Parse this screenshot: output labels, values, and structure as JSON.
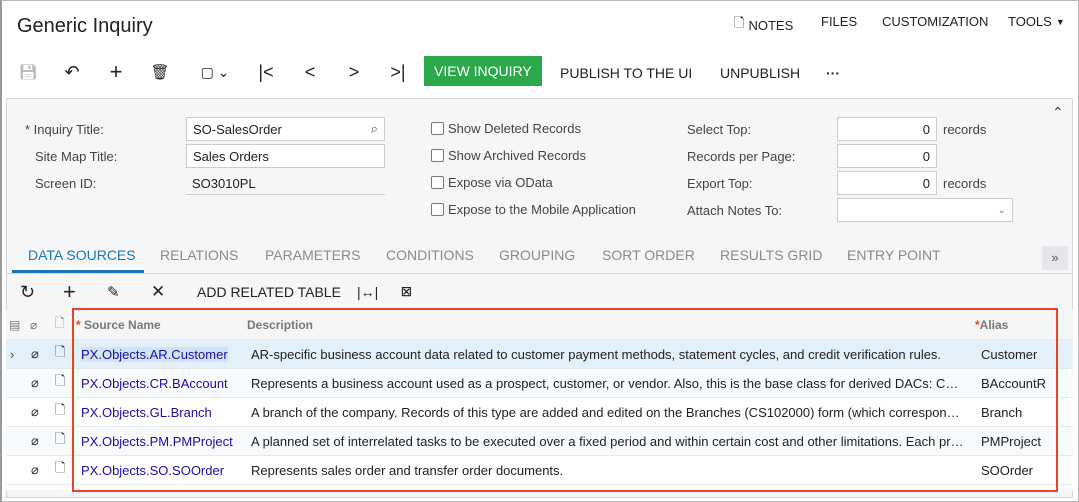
{
  "header": {
    "title": "Generic Inquiry",
    "notes": "NOTES",
    "files": "FILES",
    "customization": "CUSTOMIZATION",
    "tools": "TOOLS"
  },
  "toolbar": {
    "view_inquiry": "VIEW INQUIRY",
    "publish": "PUBLISH TO THE UI",
    "unpublish": "UNPUBLISH",
    "more": "···"
  },
  "form": {
    "inquiry_title_label": "Inquiry Title:",
    "inquiry_title": "SO-SalesOrder",
    "site_map_title_label": "Site Map Title:",
    "site_map_title": "Sales Orders",
    "screen_id_label": "Screen ID:",
    "screen_id": "SO3010PL",
    "show_deleted": "Show Deleted Records",
    "show_archived": "Show Archived Records",
    "expose_odata": "Expose via OData",
    "expose_mobile": "Expose to the Mobile Application",
    "select_top_label": "Select Top:",
    "select_top": "0",
    "records": "records",
    "records_per_page_label": "Records per Page:",
    "records_per_page": "0",
    "export_top_label": "Export Top:",
    "export_top": "0",
    "attach_notes_label": "Attach Notes To:",
    "attach_notes": ""
  },
  "tabs": [
    "DATA SOURCES",
    "RELATIONS",
    "PARAMETERS",
    "CONDITIONS",
    "GROUPING",
    "SORT ORDER",
    "RESULTS GRID",
    "ENTRY POINT"
  ],
  "grid_toolbar": {
    "add_related": "ADD RELATED TABLE"
  },
  "grid": {
    "columns": {
      "source": "Source Name",
      "description": "Description",
      "alias": "Alias"
    },
    "rows": [
      {
        "source": "PX.Objects.AR.Customer",
        "description": "AR-specific business account data related to customer payment methods, statement cycles, and credit verification rules.",
        "alias": "Customer"
      },
      {
        "source": "PX.Objects.CR.BAccount",
        "description": "Represents a business account used as a prospect, customer, or vendor. Also, this is the base class for derived DACs: C…",
        "alias": "BAccountR"
      },
      {
        "source": "PX.Objects.GL.Branch",
        "description": "A branch of the company. Records of this type are added and edited on the Branches (CS102000) form (which correspon…",
        "alias": "Branch"
      },
      {
        "source": "PX.Objects.PM.PMProject",
        "description": "A planned set of interrelated tasks to be executed over a fixed period and within certain cost and other limitations. Each pr…",
        "alias": "PMProject"
      },
      {
        "source": "PX.Objects.SO.SOOrder",
        "description": "Represents sales order and transfer order documents.",
        "alias": "SOOrder"
      }
    ]
  },
  "colors": {
    "accent": "#2aa84a",
    "tab_active": "#1b75bb",
    "highlight": "#e8442a"
  }
}
